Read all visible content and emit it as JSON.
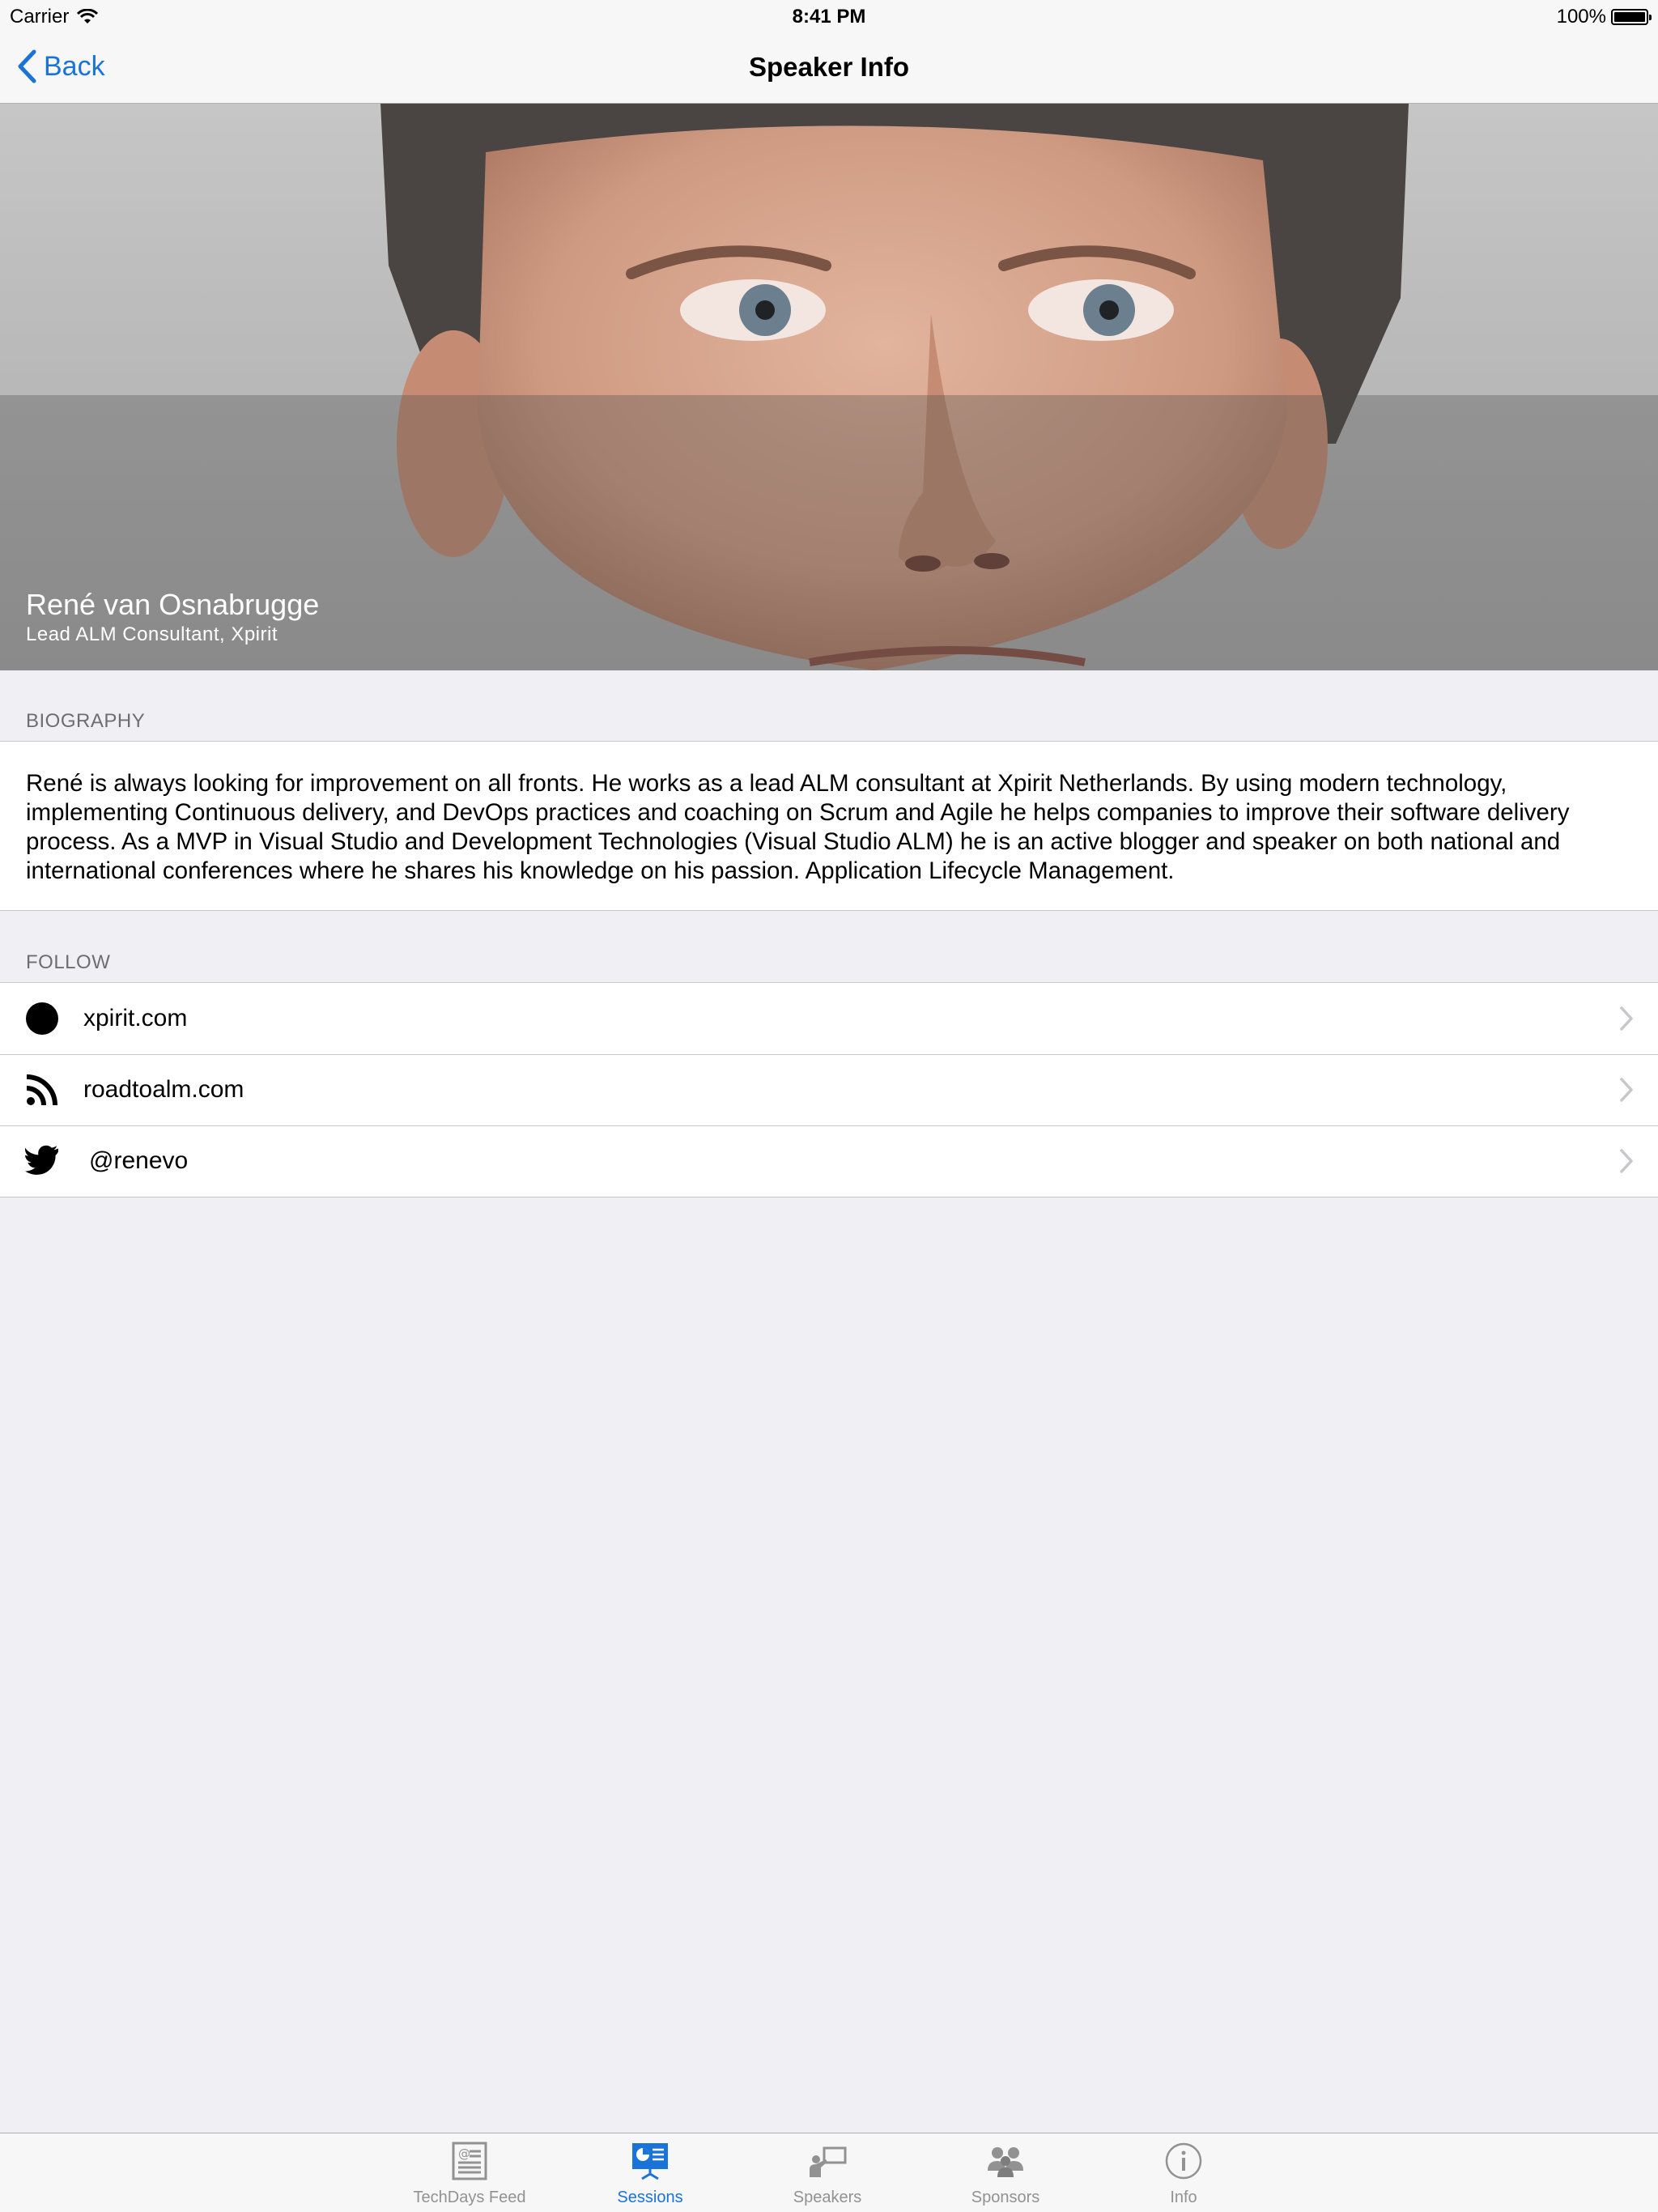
{
  "status_bar": {
    "carrier": "Carrier",
    "time": "8:41 PM",
    "battery": "100%"
  },
  "nav": {
    "back_label": "Back",
    "title": "Speaker Info"
  },
  "speaker": {
    "name": "René van Osnabrugge",
    "role": "Lead ALM Consultant, Xpirit"
  },
  "biography": {
    "header": "BIOGRAPHY",
    "text": "René is always looking for improvement on all fronts. He works as a lead ALM consultant at Xpirit Netherlands. By using modern technology, implementing Continuous delivery, and DevOps practices and coaching on Scrum and Agile he helps companies to improve their software delivery process. As a MVP in Visual Studio and Development Technologies (Visual Studio ALM) he is an active blogger and speaker on both national and international conferences where he shares his knowledge on his passion. Application Lifecycle Management."
  },
  "follow": {
    "header": "FOLLOW",
    "items": [
      {
        "label": "xpirit.com",
        "icon": "compass-icon"
      },
      {
        "label": "roadtoalm.com",
        "icon": "rss-icon"
      },
      {
        "label": "@renevo",
        "icon": "twitter-icon"
      }
    ]
  },
  "tabs": [
    {
      "label": "TechDays Feed",
      "icon": "newspaper-icon",
      "active": false
    },
    {
      "label": "Sessions",
      "icon": "presentation-icon",
      "active": true
    },
    {
      "label": "Speakers",
      "icon": "speaker-icon",
      "active": false
    },
    {
      "label": "Sponsors",
      "icon": "people-icon",
      "active": false
    },
    {
      "label": "Info",
      "icon": "info-icon",
      "active": false
    }
  ],
  "colors": {
    "accent": "#1a73d9",
    "background": "#efeff4",
    "inactive_tab": "#929292"
  }
}
